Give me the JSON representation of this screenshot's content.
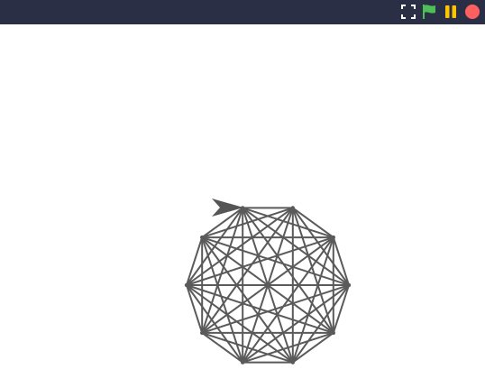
{
  "toolbar": {
    "background": "#2b2f45",
    "buttons": [
      {
        "name": "fullscreen",
        "icon": "fullscreen-icon",
        "color": "#ffffff"
      },
      {
        "name": "run",
        "icon": "green-flag-icon",
        "color": "#4cbf56"
      },
      {
        "name": "pause",
        "icon": "pause-icon",
        "color": "#ffc400"
      },
      {
        "name": "stop",
        "icon": "stop-icon",
        "color": "#ff5f5f"
      }
    ]
  },
  "stage": {
    "background": "#ffffff",
    "drawing": {
      "shape": "regular decagon with all diagonals",
      "vertex_count": 10,
      "line_color": "#5a5a5a"
    },
    "turtle": {
      "icon": "turtle-arrow-icon",
      "color": "#555555"
    }
  }
}
